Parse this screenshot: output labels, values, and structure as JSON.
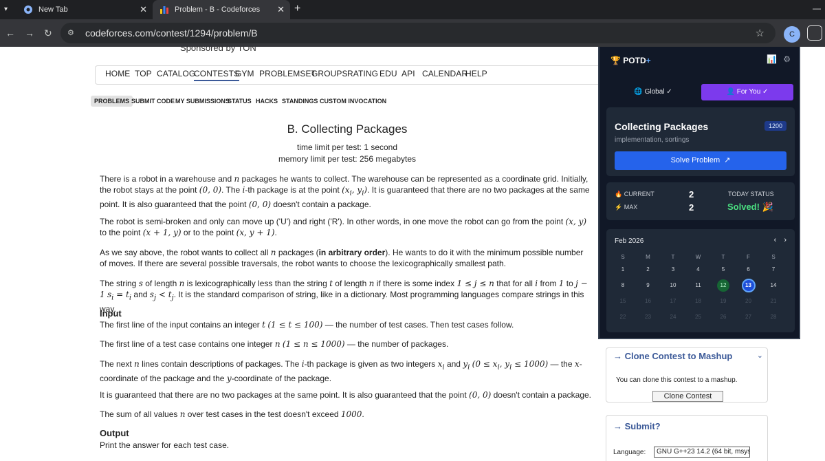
{
  "browser": {
    "tabs": [
      {
        "title": "New Tab"
      },
      {
        "title": "Problem - B - Codeforces"
      }
    ],
    "url": "codeforces.com/contest/1294/problem/B",
    "profile_initial": "C"
  },
  "site": {
    "sponsored": "Sponsored by TON",
    "menu": [
      "HOME",
      "TOP",
      "CATALOG",
      "CONTESTS",
      "GYM",
      "PROBLEMSET",
      "GROUPS",
      "RATING",
      "EDU",
      "API",
      "CALENDAR",
      "HELP"
    ],
    "active_menu": "CONTESTS",
    "submenu": [
      "PROBLEMS",
      "SUBMIT CODE",
      "MY SUBMISSIONS",
      "STATUS",
      "HACKS",
      "STANDINGS",
      "CUSTOM INVOCATION"
    ]
  },
  "problem": {
    "title": "B. Collecting Packages",
    "time_limit": "time limit per test: 1 second",
    "memory_limit": "memory limit per test: 256 megabytes",
    "input_title": "Input",
    "output_title": "Output",
    "output_text": "Print the answer for each test case."
  },
  "potd": {
    "logo": "POTD",
    "logo_plus": "+",
    "global_label": "Global ✓",
    "for_you_label": "For You ✓",
    "problem_title": "Collecting Packages",
    "tags": "implementation, sortings",
    "rating": "1200",
    "solve_label": "Solve Problem",
    "current_label": "CURRENT",
    "current_value": "2",
    "max_label": "MAX",
    "max_value": "2",
    "today_label": "TODAY STATUS",
    "today_value": "Solved!",
    "month": "Feb 2026",
    "weekdays": [
      "S",
      "M",
      "T",
      "W",
      "T",
      "F",
      "S"
    ],
    "weeks": [
      [
        "1",
        "2",
        "3",
        "4",
        "5",
        "6",
        "7"
      ],
      [
        "8",
        "9",
        "10",
        "11",
        "12",
        "13",
        "14"
      ],
      [
        "15",
        "16",
        "17",
        "18",
        "19",
        "20",
        "21"
      ],
      [
        "22",
        "23",
        "24",
        "25",
        "26",
        "27",
        "28"
      ]
    ],
    "today_day": "13",
    "solved_day": "12"
  },
  "clone": {
    "title": "→ Clone Contest to Mashup",
    "text": "You can clone this contest to a mashup.",
    "button": "Clone Contest"
  },
  "submit": {
    "title": "→ Submit?",
    "language_label": "Language:",
    "language_value": "GNU G++23 14.2 (64 bit, msys"
  }
}
